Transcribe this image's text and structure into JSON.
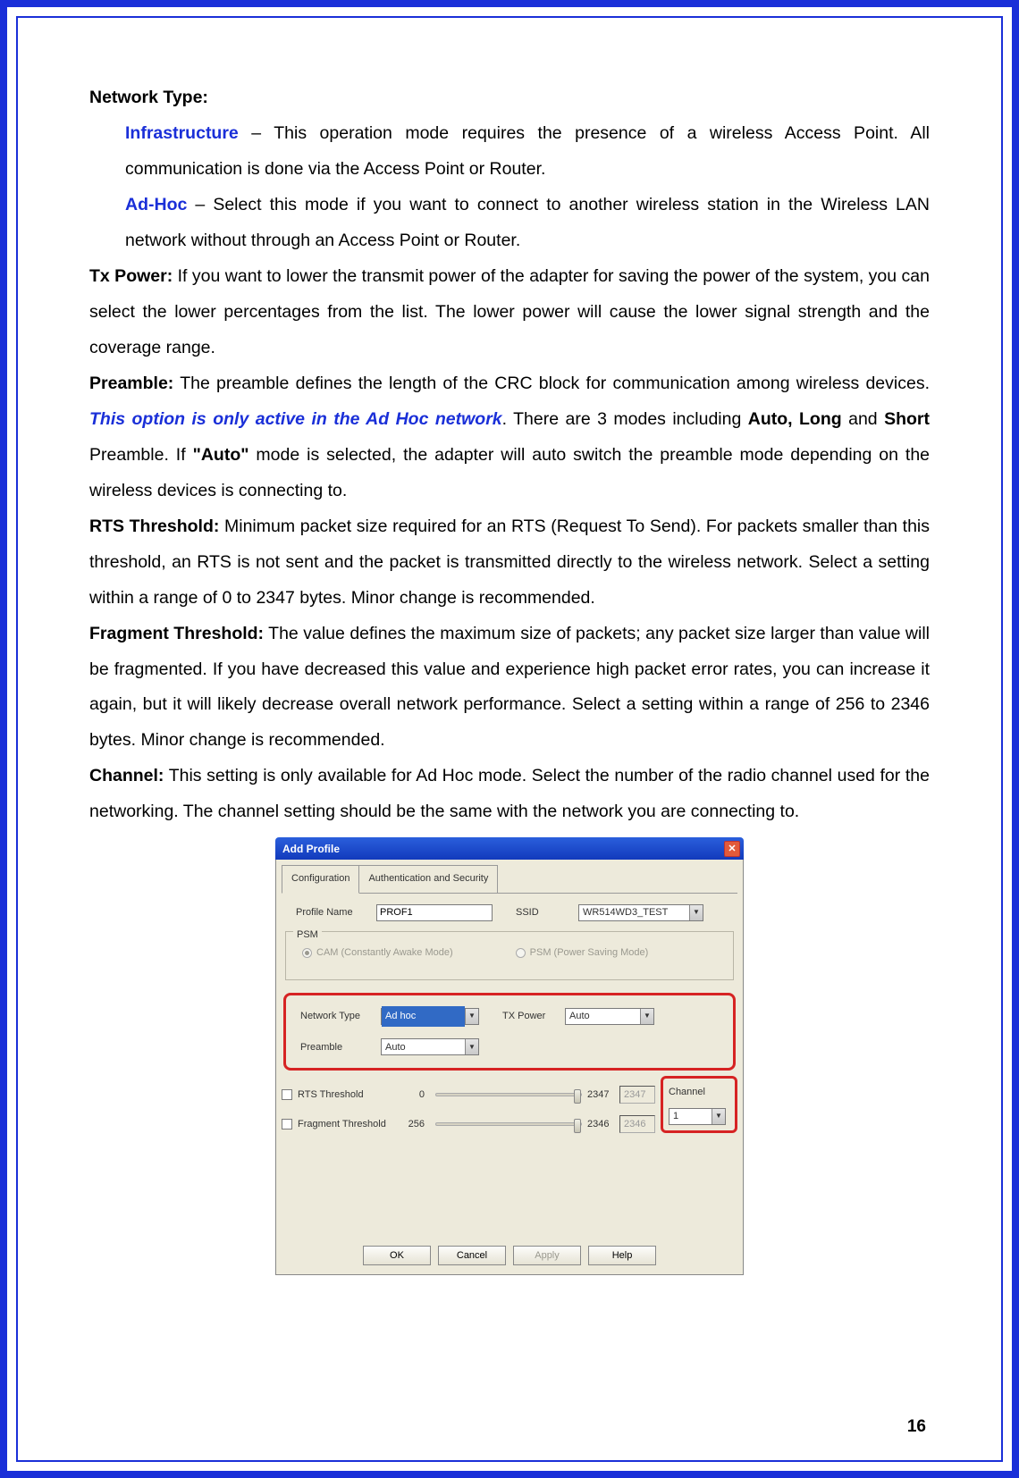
{
  "page_number": "16",
  "headings": {
    "network_type": "Network Type:",
    "tx_power": "Tx Power:",
    "preamble": "Preamble:",
    "rts": "RTS Threshold:",
    "fragment": "Fragment Threshold:",
    "channel": "Channel:"
  },
  "terms": {
    "infrastructure": "Infrastructure",
    "ad_hoc": "Ad-Hoc",
    "preamble_note": "This option is only active in the Ad Hoc network",
    "auto_long": "Auto, Long",
    "short": "Short",
    "auto_quoted": "\"Auto\""
  },
  "body": {
    "infra_text": " – This operation mode requires the presence of a wireless Access Point. All communication is done via the Access Point or Router.",
    "adhoc_text": " – Select this mode if you want to connect to another wireless station in the Wireless LAN network without through an Access Point or Router.",
    "tx_power_text": " If you want to lower the transmit power of the adapter for saving the power of the system, you can select the lower percentages from the list. The lower power will cause the lower signal strength and the coverage range.",
    "preamble_text_a": " The preamble defines the length of the CRC block for communication among wireless devices. ",
    "preamble_text_b": ". There are 3 modes including ",
    "preamble_and": " and ",
    "preamble_text_c": " Preamble. If ",
    "preamble_text_d": " mode is selected, the adapter will auto switch the preamble mode depending on the wireless devices is connecting to.",
    "rts_text": " Minimum packet size required for an RTS (Request To Send). For packets smaller than this threshold, an RTS is not sent and the packet is transmitted directly to the wireless network. Select a setting within a range of 0 to 2347 bytes. Minor change is recommended.",
    "fragment_text": " The value defines the maximum size of packets; any packet size larger than value will be fragmented. If you have decreased this value and experience high packet error rates, you can increase it again, but it will likely decrease overall network performance. Select a setting within a range of 256 to 2346 bytes. Minor change is recommended.",
    "channel_text": " This setting is only available for Ad Hoc mode. Select the number of the radio channel used for the networking. The channel setting should be the same with the network you are connecting to."
  },
  "dialog": {
    "title": "Add Profile",
    "tabs": {
      "config": "Configuration",
      "auth": "Authentication and Security"
    },
    "labels": {
      "profile_name": "Profile Name",
      "ssid": "SSID",
      "psm": "PSM",
      "cam": "CAM (Constantly Awake Mode)",
      "psm_mode": "PSM (Power Saving Mode)",
      "network_type": "Network Type",
      "tx_power": "TX Power",
      "preamble": "Preamble",
      "rts": "RTS Threshold",
      "fragment": "Fragment Threshold",
      "channel": "Channel"
    },
    "values": {
      "profile_name": "PROF1",
      "ssid": "WR514WD3_TEST",
      "network_type": "Ad hoc",
      "tx_power": "Auto",
      "preamble": "Auto",
      "rts_min": "0",
      "rts_max": "2347",
      "rts_readout": "2347",
      "frag_min": "256",
      "frag_max": "2346",
      "frag_readout": "2346",
      "channel": "1"
    },
    "buttons": {
      "ok": "OK",
      "cancel": "Cancel",
      "apply": "Apply",
      "help": "Help"
    }
  }
}
